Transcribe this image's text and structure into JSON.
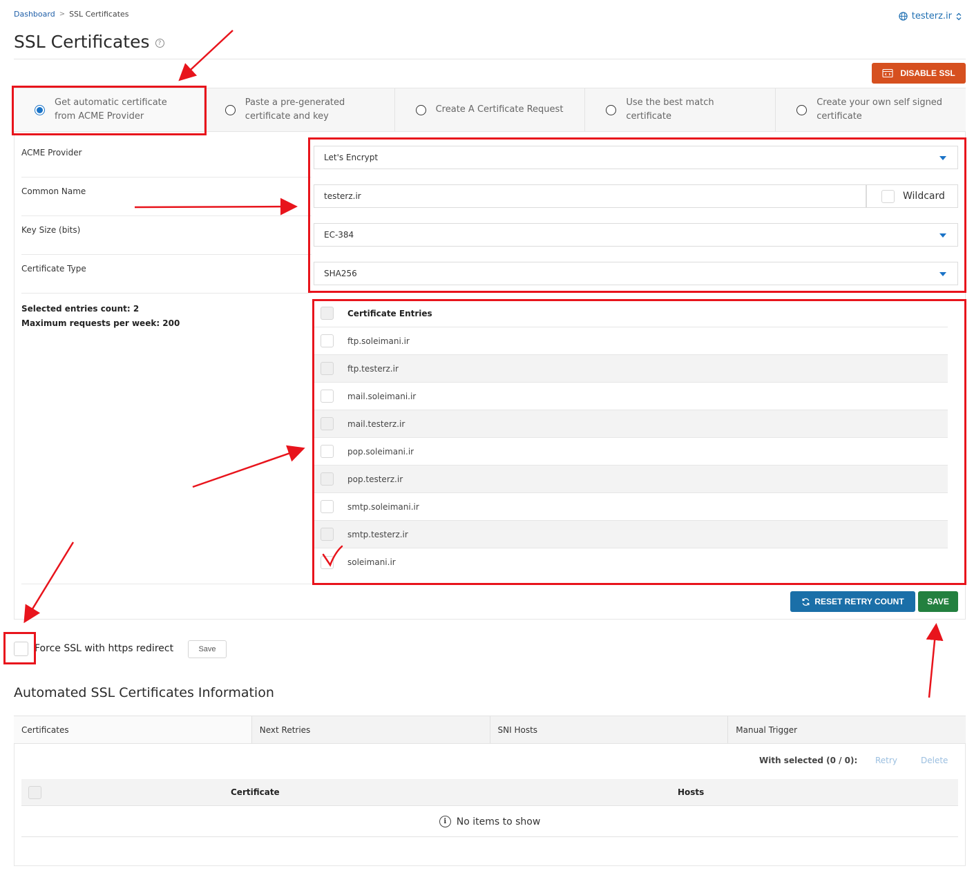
{
  "breadcrumb": {
    "home": "Dashboard",
    "separator": ">",
    "current": "SSL Certificates"
  },
  "domain_selector": {
    "value": "testerz.ir",
    "icon": "globe-icon"
  },
  "page_title": "SSL Certificates",
  "disable_ssl_button": "DISABLE SSL",
  "options": [
    {
      "label_line1": "Get automatic certificate",
      "label_line2": "from ACME Provider",
      "selected": true
    },
    {
      "label_line1": "Paste a pre-generated",
      "label_line2": "certificate and key",
      "selected": false
    },
    {
      "label_line1": "Create A Certificate Request",
      "label_line2": "",
      "selected": false
    },
    {
      "label_line1": "Use the best match",
      "label_line2": "certificate",
      "selected": false
    },
    {
      "label_line1": "Create your own self signed",
      "label_line2": "certificate",
      "selected": false
    }
  ],
  "form": {
    "acme_provider_label": "ACME Provider",
    "acme_provider_value": "Let's Encrypt",
    "common_name_label": "Common Name",
    "common_name_value": "testerz.ir",
    "wildcard_label": "Wildcard",
    "key_size_label": "Key Size (bits)",
    "key_size_value": "EC-384",
    "cert_type_label": "Certificate Type",
    "cert_type_value": "SHA256",
    "selected_count": "Selected entries count: 2",
    "max_requests": "Maximum requests per week: 200"
  },
  "entries": {
    "header": "Certificate Entries",
    "items": [
      {
        "name": "ftp.soleimani.ir"
      },
      {
        "name": "ftp.testerz.ir"
      },
      {
        "name": "mail.soleimani.ir"
      },
      {
        "name": "mail.testerz.ir"
      },
      {
        "name": "pop.soleimani.ir"
      },
      {
        "name": "pop.testerz.ir"
      },
      {
        "name": "smtp.soleimani.ir"
      },
      {
        "name": "smtp.testerz.ir"
      },
      {
        "name": "soleimani.ir"
      }
    ]
  },
  "actions": {
    "reset_retry": "RESET RETRY COUNT",
    "save": "SAVE"
  },
  "force_ssl": {
    "label": "Force SSL with https redirect",
    "save": "Save"
  },
  "automated_section": {
    "title": "Automated SSL Certificates Information",
    "tabs": [
      "Certificates",
      "Next Retries",
      "SNI Hosts",
      "Manual Trigger"
    ],
    "with_selected": "With selected (0 / 0):",
    "retry": "Retry",
    "delete": "Delete",
    "columns": [
      "Certificate",
      "Hosts"
    ],
    "empty_message": "No items to show"
  },
  "colors": {
    "accent": "#1a73c7",
    "danger": "#d6501f",
    "success": "#23803f",
    "annotation": "#e8141c"
  }
}
